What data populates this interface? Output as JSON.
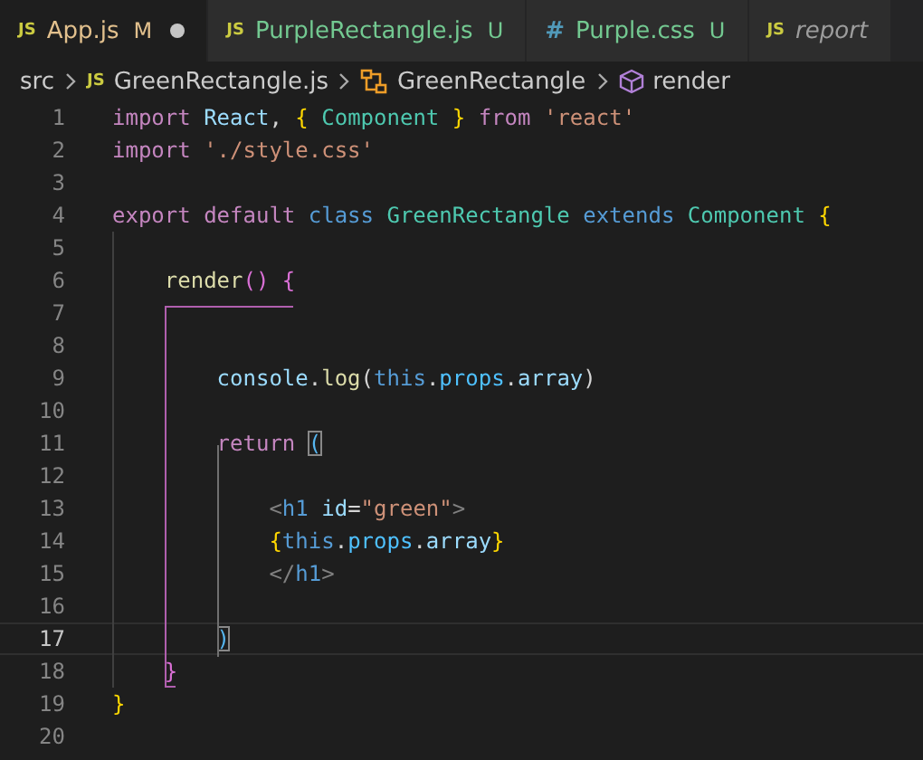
{
  "tabs": [
    {
      "kind": "js",
      "icon": "JS",
      "label": "App.js",
      "badge": "M",
      "modified": true,
      "preview": false,
      "selected": true
    },
    {
      "kind": "js",
      "icon": "JS",
      "label": "PurpleRectangle.js",
      "badge": "U",
      "modified": false,
      "preview": false,
      "selected": false
    },
    {
      "kind": "css",
      "icon": "#",
      "label": "Purple.css",
      "badge": "U",
      "modified": false,
      "preview": false,
      "selected": false
    },
    {
      "kind": "js",
      "icon": "JS",
      "label": "report",
      "modified": false,
      "preview": true,
      "selected": false
    }
  ],
  "breadcrumb": [
    {
      "kind": "folder",
      "label": "src"
    },
    {
      "kind": "js",
      "icon": "JS",
      "label": "GreenRectangle.js"
    },
    {
      "kind": "class",
      "label": "GreenRectangle"
    },
    {
      "kind": "method",
      "label": "render"
    }
  ],
  "lines": [
    {
      "number": "1",
      "current": false,
      "tokens": [
        {
          "kind": "kw",
          "text": "import "
        },
        {
          "kind": "var",
          "text": "React"
        },
        {
          "kind": "p",
          "text": ", "
        },
        {
          "kind": "brace",
          "text": "{"
        },
        {
          "kind": "cls",
          "text": " Component "
        },
        {
          "kind": "brace",
          "text": "}"
        },
        {
          "kind": "kw",
          "text": " from "
        },
        {
          "kind": "str",
          "text": "'react'"
        }
      ]
    },
    {
      "number": "2",
      "current": false,
      "tokens": [
        {
          "kind": "kw",
          "text": "import "
        },
        {
          "kind": "str",
          "text": "'./style.css'"
        }
      ]
    },
    {
      "number": "3",
      "current": false
    },
    {
      "number": "4",
      "current": false,
      "tokens": [
        {
          "kind": "kw",
          "text": "export default "
        },
        {
          "kind": "st",
          "text": "class "
        },
        {
          "kind": "cls",
          "text": "GreenRectangle "
        },
        {
          "kind": "st",
          "text": "extends "
        },
        {
          "kind": "cls",
          "text": "Component "
        },
        {
          "kind": "brace",
          "text": "{"
        }
      ]
    },
    {
      "number": "5",
      "current": false
    },
    {
      "number": "6",
      "current": false,
      "tokens": [
        {
          "kind": "fn",
          "text": "    render"
        },
        {
          "kind": "paren",
          "text": "() {"
        }
      ]
    },
    {
      "number": "7",
      "current": false
    },
    {
      "number": "8",
      "current": false
    },
    {
      "number": "9",
      "current": false,
      "tokens": [
        {
          "kind": "var",
          "text": "        console"
        },
        {
          "kind": "p",
          "text": "."
        },
        {
          "kind": "fn",
          "text": "log"
        },
        {
          "kind": "p",
          "text": "("
        },
        {
          "kind": "st",
          "text": "this"
        },
        {
          "kind": "p",
          "text": "."
        },
        {
          "kind": "prop",
          "text": "props"
        },
        {
          "kind": "p",
          "text": "."
        },
        {
          "kind": "var",
          "text": "array"
        },
        {
          "kind": "p",
          "text": ")"
        }
      ]
    },
    {
      "number": "10",
      "current": false
    },
    {
      "number": "11",
      "current": false,
      "tokens": [
        {
          "kind": "kw",
          "text": "        return "
        },
        {
          "kind": "paren2",
          "text": "(",
          "boxed": true
        }
      ]
    },
    {
      "number": "12",
      "current": false
    },
    {
      "number": "13",
      "current": false,
      "tokens": [
        {
          "kind": "tag",
          "text": "            <"
        },
        {
          "kind": "st",
          "text": "h1 "
        },
        {
          "kind": "var",
          "text": "id"
        },
        {
          "kind": "p",
          "text": "="
        },
        {
          "kind": "str",
          "text": "\"green\""
        },
        {
          "kind": "tag",
          "text": ">"
        }
      ]
    },
    {
      "number": "14",
      "current": false,
      "tokens": [
        {
          "kind": "brace",
          "text": "            {"
        },
        {
          "kind": "st",
          "text": "this"
        },
        {
          "kind": "p",
          "text": "."
        },
        {
          "kind": "prop",
          "text": "props"
        },
        {
          "kind": "p",
          "text": "."
        },
        {
          "kind": "var",
          "text": "array"
        },
        {
          "kind": "brace",
          "text": "}"
        }
      ]
    },
    {
      "number": "15",
      "current": false,
      "tokens": [
        {
          "kind": "tag",
          "text": "            </"
        },
        {
          "kind": "st",
          "text": "h1"
        },
        {
          "kind": "tag",
          "text": ">"
        }
      ]
    },
    {
      "number": "16",
      "current": false
    },
    {
      "number": "17",
      "current": true,
      "tokens": [
        {
          "kind": "paren2",
          "text": "        )",
          "boxed": true
        }
      ]
    },
    {
      "number": "18",
      "current": false,
      "tokens": [
        {
          "kind": "paren",
          "text": "    }"
        }
      ]
    },
    {
      "number": "19",
      "current": false,
      "tokens": [
        {
          "kind": "brace",
          "text": "}"
        }
      ]
    },
    {
      "number": "20",
      "current": false
    }
  ]
}
